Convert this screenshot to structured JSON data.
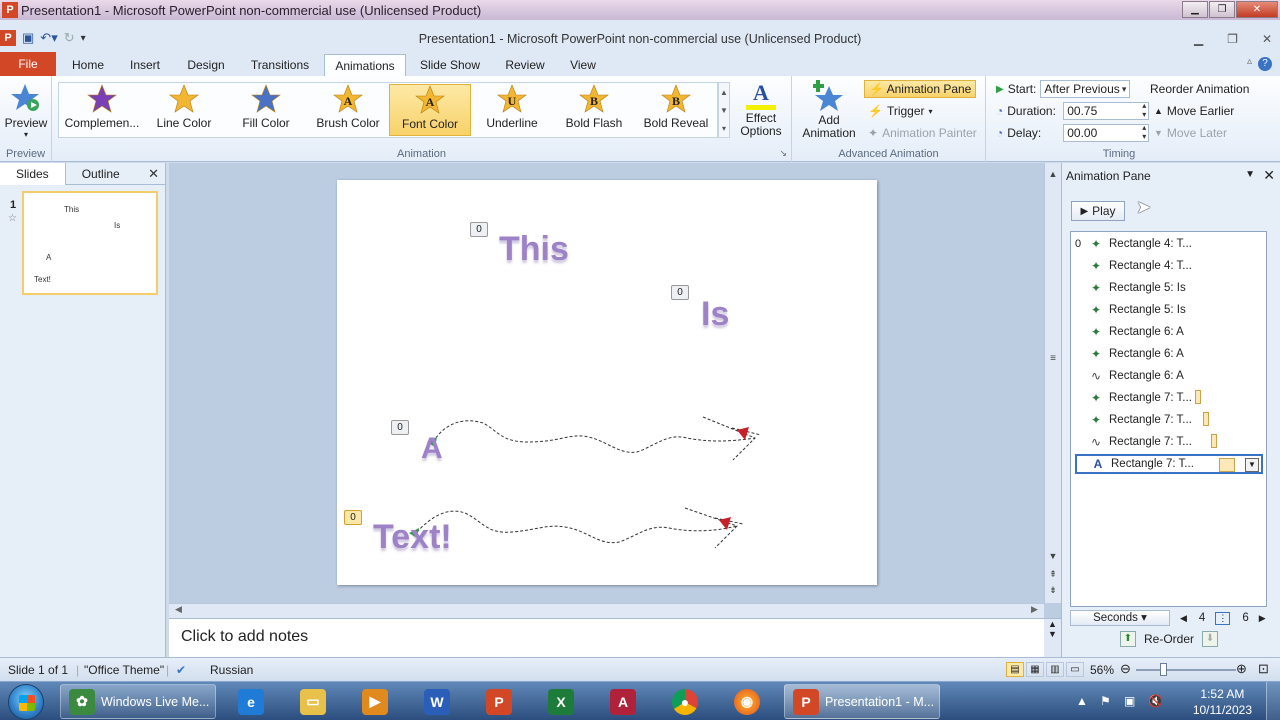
{
  "outer_title": "Presentation1 - Microsoft PowerPoint non-commercial use (Unlicensed Product)",
  "window_title": "Presentation1  -  Microsoft PowerPoint non-commercial use (Unlicensed Product)",
  "app_icon": "P",
  "tabs": [
    "File",
    "Home",
    "Insert",
    "Design",
    "Transitions",
    "Animations",
    "Slide Show",
    "Review",
    "View"
  ],
  "active_tab": "Animations",
  "ribbon": {
    "preview": {
      "label": "Preview",
      "group": "Preview"
    },
    "animation_group": "Animation",
    "gallery": [
      {
        "label": "Complemen...",
        "icon": "star-icon",
        "color": "#7b3fb5"
      },
      {
        "label": "Line Color",
        "icon": "star-icon",
        "color": "#f2b632"
      },
      {
        "label": "Fill Color",
        "icon": "star-icon",
        "color": "#4a72c4"
      },
      {
        "label": "Brush Color",
        "icon": "star-letter-icon",
        "color": "#f2b632"
      },
      {
        "label": "Font Color",
        "icon": "star-letter-icon",
        "color": "#f2b632"
      },
      {
        "label": "Underline",
        "icon": "star-letter-icon",
        "color": "#f2b632"
      },
      {
        "label": "Bold Flash",
        "icon": "star-letter-icon",
        "color": "#f2b632"
      },
      {
        "label": "Bold Reveal",
        "icon": "star-letter-icon",
        "color": "#f2b632"
      }
    ],
    "gallery_letters": [
      "",
      "",
      "",
      "A",
      "A",
      "U",
      "B",
      "B"
    ],
    "selected_gallery": "Font Color",
    "effect_options": "Effect Options",
    "effect_letter": "A",
    "add_animation": "Add Animation",
    "advanced_group": "Advanced Animation",
    "animation_pane": "Animation Pane",
    "trigger": "Trigger",
    "animation_painter": "Animation Painter",
    "timing_group": "Timing",
    "start_label": "Start:",
    "start_value": "After Previous",
    "duration_label": "Duration:",
    "duration_value": "00.75",
    "delay_label": "Delay:",
    "delay_value": "00.00",
    "reorder_label": "Reorder Animation",
    "move_earlier": "Move Earlier",
    "move_later": "Move Later"
  },
  "slides_panel": {
    "tabs": [
      "Slides",
      "Outline"
    ],
    "slide_number": "1",
    "thumb_words": [
      "This",
      "Is",
      "A",
      "Text!"
    ]
  },
  "slide": {
    "words": [
      "This",
      "Is",
      "A",
      "Text!"
    ],
    "tags": [
      "0",
      "0",
      "0",
      "0"
    ]
  },
  "notes_placeholder": "Click to add notes",
  "animation_pane": {
    "title": "Animation Pane",
    "play": "Play",
    "items": [
      {
        "num": "0",
        "icon": "emphasis-icon",
        "label": "Rectangle 4: T..."
      },
      {
        "num": "",
        "icon": "emphasis-icon",
        "label": "Rectangle 4: T..."
      },
      {
        "num": "",
        "icon": "emphasis-icon",
        "label": "Rectangle 5: Is"
      },
      {
        "num": "",
        "icon": "emphasis-icon",
        "label": "Rectangle 5: Is"
      },
      {
        "num": "",
        "icon": "emphasis-icon",
        "label": "Rectangle 6: A"
      },
      {
        "num": "",
        "icon": "emphasis-icon",
        "label": "Rectangle 6: A"
      },
      {
        "num": "",
        "icon": "motion-path-icon",
        "label": "Rectangle 6: A"
      },
      {
        "num": "",
        "icon": "emphasis-icon",
        "label": "Rectangle 7: T..."
      },
      {
        "num": "",
        "icon": "emphasis-icon",
        "label": "Rectangle 7: T..."
      },
      {
        "num": "",
        "icon": "motion-path-icon",
        "label": "Rectangle 7: T..."
      },
      {
        "num": "",
        "icon": "font-color-icon",
        "label": "Rectangle 7: T..."
      }
    ],
    "seconds_label": "Seconds",
    "timeline_start": "4",
    "timeline_end": "6",
    "reorder_label": "Re-Order"
  },
  "status": {
    "slide_info": "Slide 1 of 1",
    "theme": "\"Office Theme\"",
    "language": "Russian",
    "zoom": "56%"
  },
  "taskbar": {
    "windows_live": "Windows Live Me...",
    "presentation": "Presentation1 - M...",
    "time": "1:52 AM",
    "date": "10/11/2023"
  }
}
